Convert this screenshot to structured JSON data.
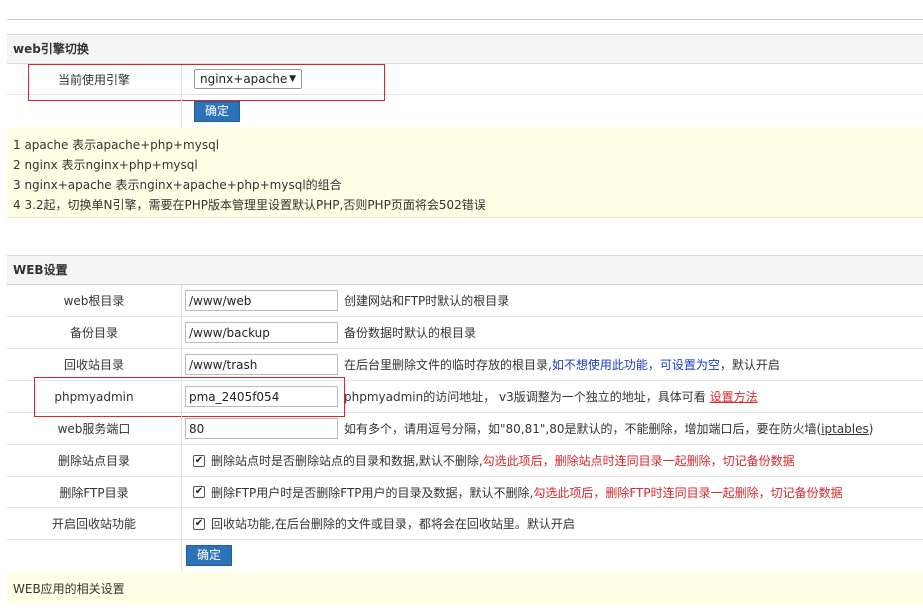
{
  "engine_section": {
    "title": "web引擎切换",
    "current_engine_label": "当前使用引擎",
    "current_engine_value": "nginx+apache",
    "confirm_label": "确定",
    "notes": [
      "1 apache     表示apache+php+mysql",
      "2 nginx      表示nginx+php+mysql",
      "3 nginx+apache 表示nginx+apache+php+mysql的组合",
      "4 3.2起，切换单N引擎，需要在PHP版本管理里设置默认PHP,否则PHP页面将会502错误"
    ]
  },
  "web_section": {
    "title": "WEB设置",
    "rows": {
      "web_root": {
        "label": "web根目录",
        "value": "/www/web",
        "desc": "创建网站和FTP时默认的根目录"
      },
      "backup": {
        "label": "备份目录",
        "value": "/www/backup",
        "desc": "备份数据时默认的根目录"
      },
      "trash": {
        "label": "回收站目录",
        "value": "/www/trash",
        "desc_a": "在后台里删除文件的临时存放的根目录,",
        "desc_b": "如不想使用此功能，可设置为空",
        "desc_c": "，默认开启"
      },
      "phpmyadmin": {
        "label": "phpmyadmin",
        "value": "pma_2405f054",
        "desc": "phpmyadmin的访问地址， v3版调整为一个独立的地址，具体可看",
        "link": "设置方法"
      },
      "port": {
        "label": "web服务端口",
        "value": "80",
        "desc": "如有多个，请用逗号分隔，如\"80,81\",80是默认的，不能删除，增加端口后，要在防火墙(",
        "link": "iptables",
        "desc_end": ")"
      },
      "del_site": {
        "label": "删除站点目录",
        "desc": "删除站点时是否删除站点的目录和数据,默认不删除,",
        "warn": "勾选此项后，删除站点时连同目录一起删除，切记备份数据"
      },
      "del_ftp": {
        "label": "删除FTP目录",
        "desc": "删除FTP用户时是否删除FTP用户的目录及数据，默认不删除,",
        "warn": "勾选此项后，删除FTP时连同目录一起删除，切记备份数据"
      },
      "recycle": {
        "label": "开启回收站功能",
        "desc": "回收站功能,在后台删除的文件或目录，都将会在回收站里。默认开启"
      }
    },
    "confirm_label": "确定",
    "footer_note": "WEB应用的相关设置"
  },
  "colors": {
    "button": "#2d72b8",
    "highlight_box": "#d9262b",
    "note_bg": "#ffffe6"
  }
}
